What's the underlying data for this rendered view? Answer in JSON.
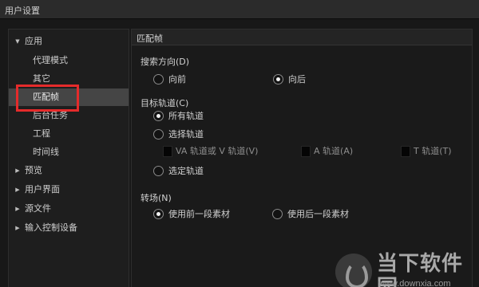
{
  "window": {
    "title": "用户设置"
  },
  "sidebar": {
    "groups": [
      {
        "label": "应用",
        "expanded": true,
        "children": [
          "代理模式",
          "其它",
          "匹配帧",
          "后台任务",
          "工程",
          "时间线"
        ]
      },
      {
        "label": "预览",
        "expanded": false
      },
      {
        "label": "用户界面",
        "expanded": false
      },
      {
        "label": "源文件",
        "expanded": false
      },
      {
        "label": "输入控制设备",
        "expanded": false
      }
    ],
    "selected": "匹配帧"
  },
  "panel": {
    "header": "匹配帧",
    "search_direction": {
      "label": "搜索方向(D)",
      "options": [
        {
          "label": "向前",
          "selected": false
        },
        {
          "label": "向后",
          "selected": true
        }
      ]
    },
    "target_track": {
      "label": "目标轨道(C)",
      "options": [
        {
          "label": "所有轨道",
          "selected": true
        },
        {
          "label": "选择轨道",
          "selected": false
        },
        {
          "label": "选定轨道",
          "selected": false
        }
      ],
      "track_checks": [
        {
          "label": "VA 轨道或 V 轨道(V)",
          "checked": false
        },
        {
          "label": "A 轨道(A)",
          "checked": false
        },
        {
          "label": "T 轨道(T)",
          "checked": false
        }
      ]
    },
    "transition": {
      "label": "转场(N)",
      "options": [
        {
          "label": "使用前一段素材",
          "selected": true
        },
        {
          "label": "使用后一段素材",
          "selected": false
        }
      ]
    }
  },
  "watermark": {
    "title": "当下软件园",
    "url": "www.downxia.com"
  },
  "colors": {
    "highlight": "#e52b2b",
    "selected_row": "#454545"
  }
}
